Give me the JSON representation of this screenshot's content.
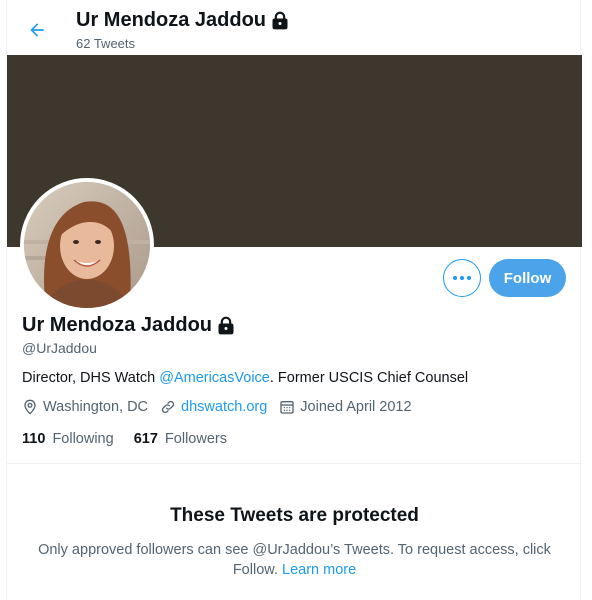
{
  "header": {
    "name": "Ur Mendoza Jaddou",
    "tweet_count": "62 Tweets",
    "icons": {
      "back": "arrow-left-icon",
      "lock": "lock-icon"
    }
  },
  "profile": {
    "name": "Ur Mendoza Jaddou",
    "handle": "@UrJaddou",
    "bio_prefix": "Director, DHS Watch ",
    "bio_mention": "@AmericasVoice",
    "bio_suffix": ". Former USCIS Chief Counsel",
    "location": "Washington, DC",
    "website": "dhswatch.org",
    "joined": "Joined April 2012",
    "following_count": "110",
    "following_label": "Following",
    "followers_count": "617",
    "followers_label": "Followers",
    "icons": {
      "location": "location-pin-icon",
      "link": "link-icon",
      "calendar": "calendar-icon"
    }
  },
  "actions": {
    "more_label": "More",
    "follow_label": "Follow"
  },
  "protected": {
    "title": "These Tweets are protected",
    "body": "Only approved followers can see @UrJaddou’s Tweets. To request access, click Follow. ",
    "learn_more": "Learn more"
  },
  "colors": {
    "accent": "#1d9bf0",
    "follow_button": "#4ba4e9",
    "banner": "#3e372e",
    "secondary_text": "#536471"
  }
}
